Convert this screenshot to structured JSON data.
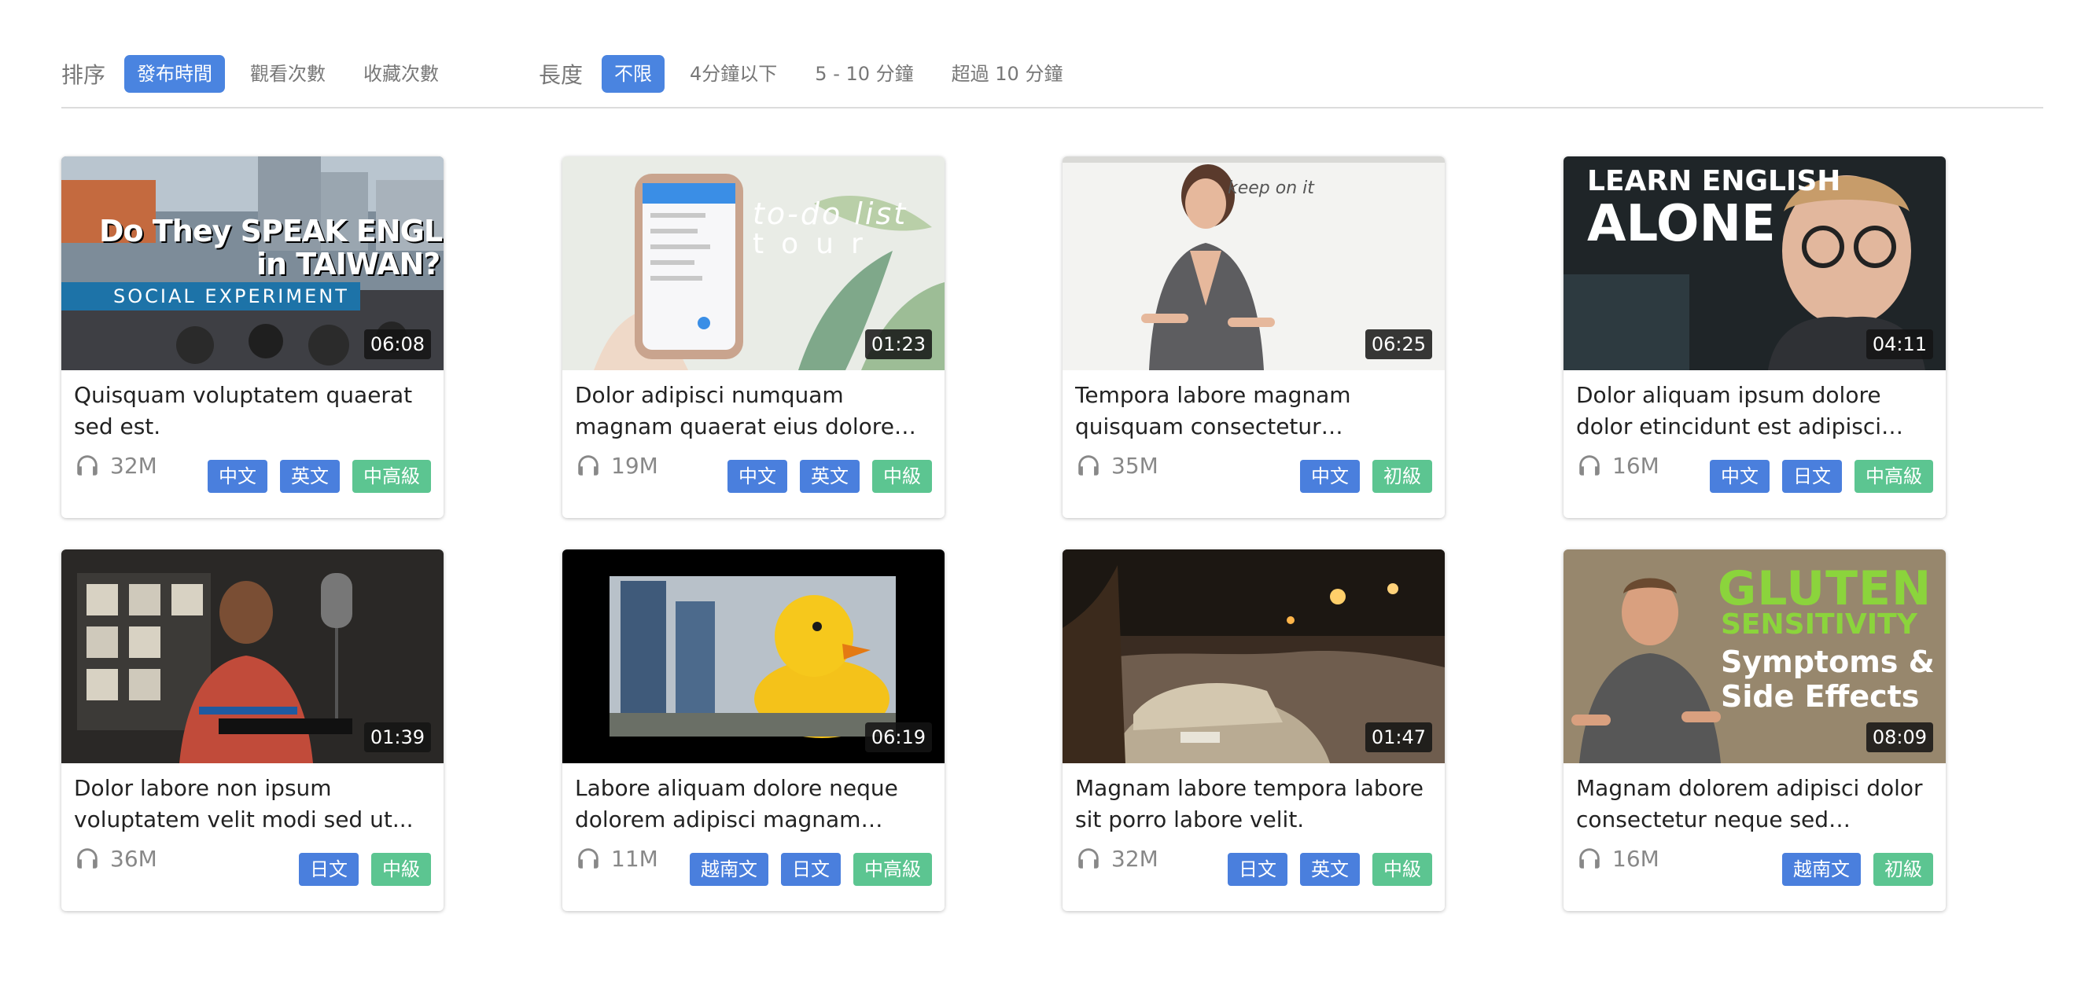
{
  "filters": {
    "sort_label": "排序",
    "sort_options": [
      "發布時間",
      "觀看次數",
      "收藏次數"
    ],
    "sort_active": "發布時間",
    "length_label": "長度",
    "length_options": [
      "不限",
      "4分鐘以下",
      "5 - 10 分鐘",
      "超過 10 分鐘"
    ],
    "length_active": "不限"
  },
  "colors": {
    "active_filter": "#4a84e0",
    "language_tag": "#4a7fdd",
    "level_tag": "#5cc591"
  },
  "videos": [
    {
      "duration": "06:08",
      "title": "Quisquam voluptatem quaerat sed est.",
      "listens": "32M",
      "languages": [
        "中文",
        "英文"
      ],
      "level": "中高級",
      "thumb_text": [
        "Do They SPEAK ENGLISH",
        "in TAIWAN?",
        "SOCIAL EXPERIMENT"
      ]
    },
    {
      "duration": "01:23",
      "title": "Dolor adipisci numquam magnam quaerat eius dolore labore...",
      "listens": "19M",
      "languages": [
        "中文",
        "英文"
      ],
      "level": "中級",
      "thumb_text": [
        "to-do list",
        "tour"
      ]
    },
    {
      "duration": "06:25",
      "title": "Tempora labore magnam quisquam consectetur magnam...",
      "listens": "35M",
      "languages": [
        "中文"
      ],
      "level": "初級",
      "thumb_text": [
        "keep on it"
      ]
    },
    {
      "duration": "04:11",
      "title": "Dolor aliquam ipsum dolore dolor etincidunt est adipisci quisquam...",
      "listens": "16M",
      "languages": [
        "中文",
        "日文"
      ],
      "level": "中高級",
      "thumb_text": [
        "LEARN ENGLISH",
        "ALONE"
      ]
    },
    {
      "duration": "01:39",
      "title": "Dolor labore non ipsum voluptatem velit modi sed ut...",
      "listens": "36M",
      "languages": [
        "日文"
      ],
      "level": "中級",
      "thumb_text": []
    },
    {
      "duration": "06:19",
      "title": "Labore aliquam dolore neque dolorem adipisci magnam quaer...",
      "listens": "11M",
      "languages": [
        "越南文",
        "日文"
      ],
      "level": "中高級",
      "thumb_text": []
    },
    {
      "duration": "01:47",
      "title": "Magnam labore tempora labore sit porro labore velit.",
      "listens": "32M",
      "languages": [
        "日文",
        "英文"
      ],
      "level": "中級",
      "thumb_text": []
    },
    {
      "duration": "08:09",
      "title": "Magnam dolorem adipisci dolor consectetur neque sed quaerat...",
      "listens": "16M",
      "languages": [
        "越南文"
      ],
      "level": "初級",
      "thumb_text": [
        "GLUTEN",
        "SENSITIVITY",
        "Symptoms &",
        "Side Effects"
      ]
    }
  ]
}
